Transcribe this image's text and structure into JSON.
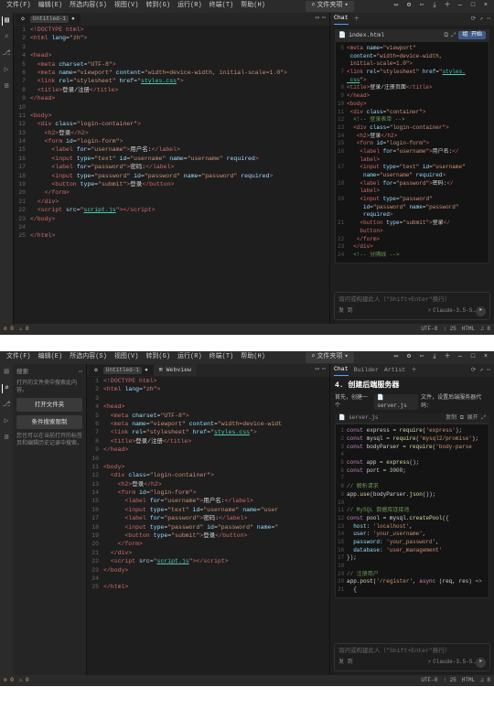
{
  "menubar": {
    "items": [
      "文件(F)",
      "编辑(E)",
      "所选内容(S)",
      "视图(V)",
      "转到(G)",
      "运行(R)",
      "终端(T)",
      "帮助(H)"
    ],
    "center_label": "文件夹项",
    "center_arrow": "▾"
  },
  "win_controls": {
    "min": "—",
    "max": "□",
    "close": "×"
  },
  "tab_actions": {
    "layout": "▭",
    "settings": "⚙",
    "more": "⋯",
    "download": "⤓",
    "new": "＋"
  },
  "instances": [
    {
      "has_sidebar": false,
      "sidebar": null,
      "editor": {
        "tab_title": "<!DOCTYPE html>",
        "tab_second_label": "Untitled-1",
        "tab_dot": "●",
        "lang_badge": "",
        "webview_tab": "",
        "lines": [
          {
            "n": 1,
            "html": "<span class='tagred'>&lt;!DOCTYPE html&gt;</span>"
          },
          {
            "n": 2,
            "html": "<span class='tagred'>&lt;html</span> <span class='attr'>lang</span>=<span class='str'>\"zh\"</span><span class='tagred'>&gt;</span>"
          },
          {
            "n": 3,
            "html": ""
          },
          {
            "n": 4,
            "html": "<span class='tagred'>&lt;head&gt;</span>"
          },
          {
            "n": 5,
            "html": "  <span class='tagred'>&lt;meta</span> <span class='attr'>charset</span>=<span class='str'>\"UTF-8\"</span><span class='tagred'>&gt;</span>"
          },
          {
            "n": 6,
            "html": "  <span class='tagred'>&lt;meta</span> <span class='attr'>name</span>=<span class='str'>\"viewport\"</span> <span class='attr'>content</span>=<span class='str'>\"width=device-width, initial-scale=1.0\"</span><span class='tagred'>&gt;</span>"
          },
          {
            "n": 7,
            "html": "  <span class='tagred'>&lt;link</span> <span class='attr'>rel</span>=<span class='str'>\"stylesheet\"</span> <span class='attr'>href</span>=<span class='str'>\"</span><span class='link'>styles.css</span><span class='str'>\"</span><span class='tagred'>&gt;</span>"
          },
          {
            "n": 8,
            "html": "  <span class='tagred'>&lt;title&gt;</span><span class='pl'>登录/注册</span><span class='tagred'>&lt;/title&gt;</span>"
          },
          {
            "n": 9,
            "html": "<span class='tagred'>&lt;/head&gt;</span>"
          },
          {
            "n": 10,
            "html": ""
          },
          {
            "n": 11,
            "html": "<span class='tagred'>&lt;body&gt;</span>"
          },
          {
            "n": 12,
            "html": "  <span class='tagred'>&lt;div</span> <span class='attr'>class</span>=<span class='str'>\"login-container\"</span><span class='tagred'>&gt;</span>"
          },
          {
            "n": 13,
            "html": "    <span class='tagred'>&lt;h2&gt;</span><span class='pl'>登录</span><span class='tagred'>&lt;/h2&gt;</span>"
          },
          {
            "n": 14,
            "html": "    <span class='tagred'>&lt;form</span> <span class='attr'>id</span>=<span class='str'>\"login-form\"</span><span class='tagred'>&gt;</span>"
          },
          {
            "n": 15,
            "html": "      <span class='tagred'>&lt;label</span> <span class='attr'>for</span>=<span class='str'>\"username\"</span><span class='tagred'>&gt;</span><span class='pl'>用户名:</span><span class='tagred'>&lt;/label&gt;</span>"
          },
          {
            "n": 16,
            "html": "      <span class='tagred'>&lt;input</span> <span class='attr'>type</span>=<span class='str'>\"text\"</span> <span class='attr'>id</span>=<span class='str'>\"username\"</span> <span class='attr'>name</span>=<span class='str'>\"username\"</span> <span class='attr'>required</span><span class='tagred'>&gt;</span>"
          },
          {
            "n": 17,
            "html": "      <span class='tagred'>&lt;label</span> <span class='attr'>for</span>=<span class='str'>\"password\"</span><span class='tagred'>&gt;</span><span class='pl'>密码:</span><span class='tagred'>&lt;/label&gt;</span>"
          },
          {
            "n": 18,
            "html": "      <span class='tagred'>&lt;input</span> <span class='attr'>type</span>=<span class='str'>\"password\"</span> <span class='attr'>id</span>=<span class='str'>\"password\"</span> <span class='attr'>name</span>=<span class='str'>\"password\"</span> <span class='attr'>required</span><span class='tagred'>&gt;</span>"
          },
          {
            "n": 19,
            "html": "      <span class='tagred'>&lt;button</span> <span class='attr'>type</span>=<span class='str'>\"submit\"</span><span class='tagred'>&gt;</span><span class='pl'>登录</span><span class='tagred'>&lt;/button&gt;</span>"
          },
          {
            "n": 20,
            "html": "    <span class='tagred'>&lt;/form&gt;</span>"
          },
          {
            "n": 21,
            "html": "  <span class='tagred'>&lt;/div&gt;</span>"
          },
          {
            "n": 22,
            "html": "  <span class='tagred'>&lt;script</span> <span class='attr'>src</span>=<span class='str'>\"</span><span class='link'>script.js</span><span class='str'>\"</span><span class='tagred'>&gt;&lt;/script&gt;</span>"
          },
          {
            "n": 23,
            "html": "<span class='tagred'>&lt;/body&gt;</span>"
          },
          {
            "n": 24,
            "html": ""
          },
          {
            "n": 25,
            "html": "<span class='tagred'>&lt;/html&gt;</span>"
          }
        ]
      },
      "chat": {
        "tabs": [
          "Chat"
        ],
        "filerow_name": "index.html",
        "filerow_btn": "组 开始",
        "show_heading": false,
        "heading": "",
        "subline": "",
        "code_header_file": "",
        "code_header_right": "",
        "code_lines": [
          {
            "n": 5,
            "html": "<span class='tagred'>&lt;meta</span> <span class='attr'>name</span>=<span class='str'>\"viewport\"</span>"
          },
          {
            "n": "",
            "html": "<span class='attr'>&nbsp;content</span>=<span class='str'>\"width=device-width,</span>"
          },
          {
            "n": "",
            "html": "<span class='str'>&nbsp;initial-scale=1.0\"</span><span class='tagred'>&gt;</span>"
          },
          {
            "n": 7,
            "html": "<span class='tagred'>&lt;link</span> <span class='attr'>rel</span>=<span class='str'>\"stylesheet\"</span> <span class='attr'>href</span>=<span class='str'>\"</span><span class='link'>styles.</span>"
          },
          {
            "n": "",
            "html": "<span class='link'>&nbsp;css</span><span class='str'>\"</span><span class='tagred'>&gt;</span>"
          },
          {
            "n": 8,
            "html": "<span class='tagred'>&lt;title&gt;</span><span class='pl'>登录/注册页面</span><span class='tagred'>&lt;/title&gt;</span>"
          },
          {
            "n": 9,
            "html": "<span class='tagred'>&lt;/head&gt;</span>"
          },
          {
            "n": 10,
            "html": "<span class='tagred'>&lt;body&gt;</span>"
          },
          {
            "n": 11,
            "html": " <span class='tagred'>&lt;div</span> <span class='attr'>class</span>=<span class='str'>\"container\"</span><span class='tagred'>&gt;</span>"
          },
          {
            "n": 12,
            "html": "  <span class='cmt'>&lt;!-- 登录表单 --&gt;</span>"
          },
          {
            "n": 13,
            "html": "  <span class='tagred'>&lt;div</span> <span class='attr'>class</span>=<span class='str'>\"login-container\"</span><span class='tagred'>&gt;</span>"
          },
          {
            "n": 14,
            "html": "   <span class='tagred'>&lt;h2&gt;</span><span class='pl'>登录</span><span class='tagred'>&lt;/h2&gt;</span>"
          },
          {
            "n": 15,
            "html": "   <span class='tagred'>&lt;form</span> <span class='attr'>id</span>=<span class='str'>\"login-form\"</span><span class='tagred'>&gt;</span>"
          },
          {
            "n": 16,
            "html": "    <span class='tagred'>&lt;label</span> <span class='attr'>for</span>=<span class='str'>\"username\"</span><span class='tagred'>&gt;</span><span class='pl'>用户名:</span><span class='tagred'>&lt;/</span>"
          },
          {
            "n": "",
            "html": "    <span class='tagred'>label&gt;</span>"
          },
          {
            "n": 17,
            "html": "    <span class='tagred'>&lt;input</span> <span class='attr'>type</span>=<span class='str'>\"text\"</span> <span class='attr'>id</span>=<span class='str'>\"username\"</span>"
          },
          {
            "n": "",
            "html": "    <span class='attr'>&nbsp;name</span>=<span class='str'>\"username\"</span> <span class='attr'>required</span><span class='tagred'>&gt;</span>"
          },
          {
            "n": 18,
            "html": "    <span class='tagred'>&lt;label</span> <span class='attr'>for</span>=<span class='str'>\"password\"</span><span class='tagred'>&gt;</span><span class='pl'>密码:</span><span class='tagred'>&lt;/</span>"
          },
          {
            "n": "",
            "html": "    <span class='tagred'>label&gt;</span>"
          },
          {
            "n": 19,
            "html": "    <span class='tagred'>&lt;input</span> <span class='attr'>type</span>=<span class='str'>\"password\"</span>"
          },
          {
            "n": "",
            "html": "    <span class='attr'>&nbsp;id</span>=<span class='str'>\"password\"</span> <span class='attr'>name</span>=<span class='str'>\"password\"</span>"
          },
          {
            "n": "",
            "html": "    <span class='attr'>&nbsp;required</span><span class='tagred'>&gt;</span>"
          },
          {
            "n": 21,
            "html": "    <span class='tagred'>&lt;button</span> <span class='attr'>type</span>=<span class='str'>\"submit\"</span><span class='tagred'>&gt;</span><span class='pl'>登录</span><span class='tagred'>&lt;/</span>"
          },
          {
            "n": "",
            "html": "    <span class='tagred'>button&gt;</span>"
          },
          {
            "n": 22,
            "html": "   <span class='tagred'>&lt;/form&gt;</span>"
          },
          {
            "n": 23,
            "html": "  <span class='tagred'>&lt;/div&gt;</span>"
          },
          {
            "n": 24,
            "html": "  <span class='cmt'>&lt;!-- 分隔线 --&gt;</span>"
          }
        ],
        "input_placeholder": "询问或构建此人（\"Shift+Enter\"换行）",
        "footer_label": "发 到",
        "model": "Claude-3.5-S…",
        "send_icon": "➤"
      },
      "status": {
        "left_warn": "⚠ 0",
        "left_err": "⊘ 0",
        "right": [
          "UTF-8",
          "↑ 25",
          "HTML",
          "♫ 8"
        ]
      }
    },
    {
      "has_sidebar": true,
      "sidebar": {
        "title": "搜索",
        "hint": "打开的文件夹中搜索此内容。",
        "open_folder_btn": "打开文件夹",
        "toggle_btn": "条件搜索限制",
        "note": "您也可以在当前打开的标签页和编辑历史记录中搜索。"
      },
      "editor": {
        "tab_title": "<!DOCTYPE html>",
        "tab_second_label": "Untitled-1",
        "tab_dot": "●",
        "lang_badge": "",
        "webview_tab": "⊞ Webview",
        "lines": [
          {
            "n": 1,
            "html": "<span class='tagred'>&lt;!DOCTYPE html&gt;</span>"
          },
          {
            "n": 2,
            "html": "<span class='tagred'>&lt;html</span> <span class='attr'>lang</span>=<span class='str'>\"zh\"</span><span class='tagred'>&gt;</span>"
          },
          {
            "n": 3,
            "html": ""
          },
          {
            "n": 4,
            "html": "<span class='tagred'>&lt;head&gt;</span>"
          },
          {
            "n": 5,
            "html": "  <span class='tagred'>&lt;meta</span> <span class='attr'>charset</span>=<span class='str'>\"UTF-8\"</span><span class='tagred'>&gt;</span>"
          },
          {
            "n": 6,
            "html": "  <span class='tagred'>&lt;meta</span> <span class='attr'>name</span>=<span class='str'>\"viewport\"</span> <span class='attr'>content</span>=<span class='str'>\"width=device-widt</span>"
          },
          {
            "n": 7,
            "html": "  <span class='tagred'>&lt;link</span> <span class='attr'>rel</span>=<span class='str'>\"stylesheet\"</span> <span class='attr'>href</span>=<span class='str'>\"</span><span class='link'>styles.css</span><span class='str'>\"</span><span class='tagred'>&gt;</span>"
          },
          {
            "n": 8,
            "html": "  <span class='tagred'>&lt;title&gt;</span><span class='pl'>登录/注册</span><span class='tagred'>&lt;/title&gt;</span>"
          },
          {
            "n": 9,
            "html": "<span class='tagred'>&lt;/head&gt;</span>"
          },
          {
            "n": 10,
            "html": ""
          },
          {
            "n": 11,
            "html": "<span class='tagred'>&lt;body&gt;</span>"
          },
          {
            "n": 12,
            "html": "  <span class='tagred'>&lt;div</span> <span class='attr'>class</span>=<span class='str'>\"login-container\"</span><span class='tagred'>&gt;</span>"
          },
          {
            "n": 13,
            "html": "    <span class='tagred'>&lt;h2&gt;</span><span class='pl'>登录</span><span class='tagred'>&lt;/h2&gt;</span>"
          },
          {
            "n": 14,
            "html": "    <span class='tagred'>&lt;form</span> <span class='attr'>id</span>=<span class='str'>\"login-form\"</span><span class='tagred'>&gt;</span>"
          },
          {
            "n": 15,
            "html": "      <span class='tagred'>&lt;label</span> <span class='attr'>for</span>=<span class='str'>\"username\"</span><span class='tagred'>&gt;</span><span class='pl'>用户名:</span><span class='tagred'>&lt;/label&gt;</span>"
          },
          {
            "n": 16,
            "html": "      <span class='tagred'>&lt;input</span> <span class='attr'>type</span>=<span class='str'>\"text\"</span> <span class='attr'>id</span>=<span class='str'>\"username\"</span> <span class='attr'>name</span>=<span class='str'>\"user</span>"
          },
          {
            "n": 17,
            "html": "      <span class='tagred'>&lt;label</span> <span class='attr'>for</span>=<span class='str'>\"password\"</span><span class='tagred'>&gt;</span><span class='pl'>密码:</span><span class='tagred'>&lt;/label&gt;</span>"
          },
          {
            "n": 18,
            "html": "      <span class='tagred'>&lt;input</span> <span class='attr'>type</span>=<span class='str'>\"password\"</span> <span class='attr'>id</span>=<span class='str'>\"password\"</span> <span class='attr'>name</span>=<span class='str'>\"</span>"
          },
          {
            "n": 19,
            "html": "      <span class='tagred'>&lt;button</span> <span class='attr'>type</span>=<span class='str'>\"submit\"</span><span class='tagred'>&gt;</span><span class='pl'>登录</span><span class='tagred'>&lt;/button&gt;</span>"
          },
          {
            "n": 20,
            "html": "    <span class='tagred'>&lt;/form&gt;</span>"
          },
          {
            "n": 21,
            "html": "  <span class='tagred'>&lt;/div&gt;</span>"
          },
          {
            "n": 22,
            "html": "  <span class='tagred'>&lt;script</span> <span class='attr'>src</span>=<span class='str'>\"</span><span class='link'>script.js</span><span class='str'>\"</span><span class='tagred'>&gt;&lt;/script&gt;</span>"
          },
          {
            "n": 23,
            "html": "<span class='tagred'>&lt;/body&gt;</span>"
          },
          {
            "n": 24,
            "html": ""
          },
          {
            "n": 25,
            "html": "<span class='tagred'>&lt;/html&gt;</span>"
          }
        ]
      },
      "chat": {
        "tabs": [
          "Chat",
          "Builder",
          "Artist"
        ],
        "filerow_name": "server.js",
        "filerow_btn": "组 开始",
        "show_heading": true,
        "heading": "4. 创建后端服务器",
        "subline": "首先，创建一个 server.js 文件，设置后端服务器代码：",
        "code_header_file": "server.js",
        "code_header_right": "复制 ⧉  展开 ⤢",
        "code_lines": [
          {
            "n": 1,
            "html": "<span class='kw'>const</span> <span class='pl'>express</span> = <span class='fn'>require</span>(<span class='str'>'express'</span>);"
          },
          {
            "n": 2,
            "html": "<span class='kw'>const</span> <span class='pl'>mysql</span> = <span class='fn'>require</span>(<span class='str'>'mysql2/promise'</span>);"
          },
          {
            "n": 3,
            "html": "<span class='kw'>const</span> <span class='pl'>bodyParser</span> = <span class='fn'>require</span>(<span class='str'>'body-parse</span>"
          },
          {
            "n": 4,
            "html": ""
          },
          {
            "n": 5,
            "html": "<span class='kw'>const</span> <span class='pl'>app</span> = <span class='fn'>express</span>();"
          },
          {
            "n": 6,
            "html": "<span class='kw'>const</span> <span class='pl'>port</span> = <span class='num'>3000</span>;"
          },
          {
            "n": 7,
            "html": ""
          },
          {
            "n": 8,
            "html": "<span class='cmt'>// 解析请求</span>"
          },
          {
            "n": 9,
            "html": "<span class='pl'>app</span>.<span class='fn'>use</span>(<span class='pl'>bodyParser</span>.<span class='fn'>json</span>());"
          },
          {
            "n": 10,
            "html": ""
          },
          {
            "n": 11,
            "html": "<span class='cmt'>// MySQL 数据库连接池</span>"
          },
          {
            "n": 12,
            "html": "<span class='kw'>const</span> <span class='pl'>pool</span> = <span class='pl'>mysql</span>.<span class='fn'>createPool</span>({"
          },
          {
            "n": 13,
            "html": "  <span class='attr'>host</span>: <span class='str'>'localhost'</span>,"
          },
          {
            "n": 14,
            "html": "  <span class='attr'>user</span>: <span class='str'>'your_username'</span>,"
          },
          {
            "n": 15,
            "html": "  <span class='attr'>password</span>: <span class='str'>'your_password'</span>,"
          },
          {
            "n": 16,
            "html": "  <span class='attr'>database</span>: <span class='str'>'user_management'</span>"
          },
          {
            "n": 17,
            "html": "});"
          },
          {
            "n": 18,
            "html": ""
          },
          {
            "n": 19,
            "html": "<span class='cmt'>// 注册用户</span>"
          },
          {
            "n": 20,
            "html": "<span class='pl'>app</span>.<span class='fn'>post</span>(<span class='str'>'/register'</span>, <span class='kw'>async</span> (<span class='pl'>req</span>, <span class='pl'>res</span>) <span class='kw'>=&gt;</span>"
          },
          {
            "n": 21,
            "html": "  {"
          }
        ],
        "input_placeholder": "询问或构建此人（\"Shift+Enter\"换行）",
        "footer_label": "发 到",
        "model": "Claude-3.5-S…",
        "send_icon": "➤"
      },
      "status": {
        "left_warn": "⚠ 0",
        "left_err": "⊘ 0",
        "right": [
          "UTF-8",
          "↑ 25",
          "HTML",
          "♫ 8"
        ]
      }
    }
  ]
}
